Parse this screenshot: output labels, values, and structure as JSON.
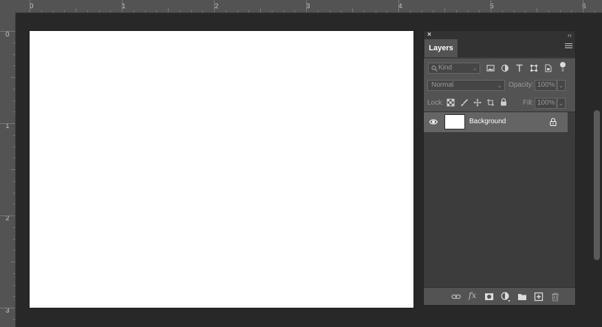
{
  "rulers": {
    "horizontal_labels": [
      "0",
      "1",
      "2",
      "3",
      "4",
      "5",
      "6"
    ],
    "vertical_labels": [
      "0",
      "1",
      "2",
      "3"
    ]
  },
  "layers_panel": {
    "close_glyph": "×",
    "collapse_glyph": "‹‹",
    "tab_label": "Layers",
    "filter": {
      "placeholder": "Kind"
    },
    "blend_mode": "Normal",
    "opacity_label": "Opacity:",
    "opacity_value": "100%",
    "lock_label": "Lock:",
    "fill_label": "Fill:",
    "fill_value": "100%",
    "layers": [
      {
        "name": "Background",
        "visible": true,
        "locked": true
      }
    ],
    "footer_fx_label": "fx"
  },
  "colors": {
    "panel_bg": "#3c3c3c",
    "selected_layer": "#646464",
    "ruler": "#535353",
    "canvas": "#ffffff"
  }
}
